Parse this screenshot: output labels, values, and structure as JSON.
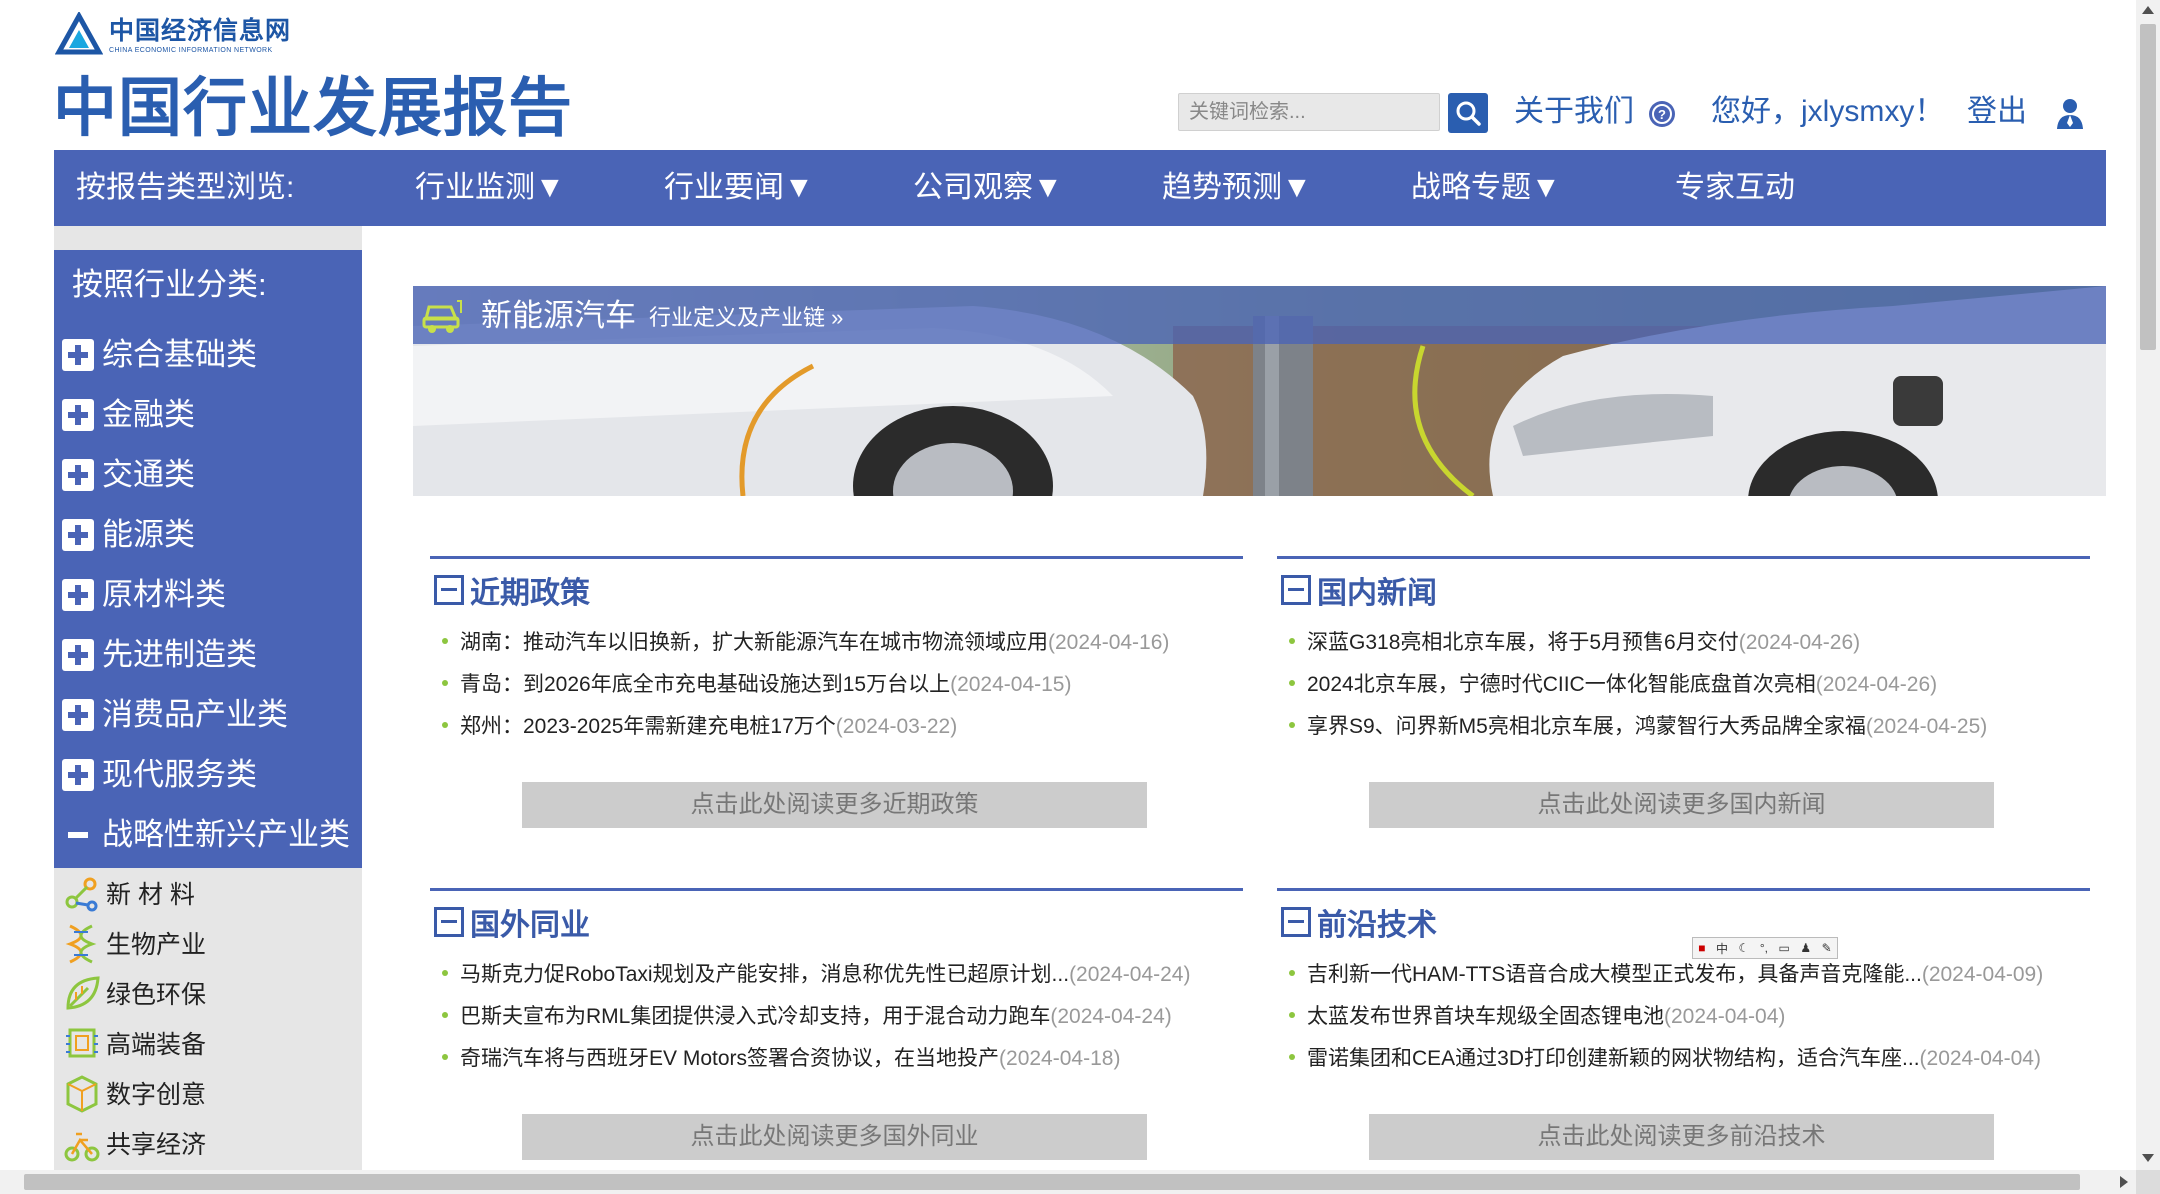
{
  "header": {
    "logo_cn": "中国经济信息网",
    "logo_en": "CHINA ECONOMIC INFORMATION NETWORK",
    "site_title": "中国行业发展报告",
    "search_placeholder": "关键词检索...",
    "about": "关于我们",
    "greeting": "您好，jxlysmxy！",
    "logout": "登出"
  },
  "nav": {
    "browse_label": "按报告类型浏览:",
    "items": [
      "行业监测▼",
      "行业要闻▼",
      "公司观察▼",
      "趋势预测▼",
      "战略专题▼",
      "专家互动"
    ]
  },
  "sidebar": {
    "heading": "按照行业分类:",
    "categories": [
      "综合基础类",
      "金融类",
      "交通类",
      "能源类",
      "原材料类",
      "先进制造类",
      "消费品产业类",
      "现代服务类"
    ],
    "expanded": "战略性新兴产业类",
    "subitems": [
      "新 材 料",
      "生物产业",
      "绿色环保",
      "高端装备",
      "数字创意",
      "共享经济"
    ]
  },
  "banner": {
    "title": "新能源汽车",
    "subtitle": "行业定义及产业链 »"
  },
  "sections": [
    {
      "title": "近期政策",
      "items": [
        {
          "title": "湖南：推动汽车以旧换新，扩大新能源汽车在城市物流领域应用",
          "date": "(2024-04-16)"
        },
        {
          "title": "青岛：到2026年底全市充电基础设施达到15万台以上",
          "date": "(2024-04-15)"
        },
        {
          "title": "郑州：2023-2025年需新建充电桩17万个",
          "date": "(2024-03-22)"
        }
      ],
      "more": "点击此处阅读更多近期政策"
    },
    {
      "title": "国内新闻",
      "items": [
        {
          "title": "深蓝G318亮相北京车展，将于5月预售6月交付",
          "date": "(2024-04-26)"
        },
        {
          "title": "2024北京车展，宁德时代CIIC一体化智能底盘首次亮相",
          "date": "(2024-04-26)"
        },
        {
          "title": "享界S9、问界新M5亮相北京车展，鸿蒙智行大秀品牌全家福",
          "date": "(2024-04-25)"
        }
      ],
      "more": "点击此处阅读更多国内新闻"
    },
    {
      "title": "国外同业",
      "items": [
        {
          "title": "马斯克力促RoboTaxi规划及产能安排，消息称优先性已超原计划...",
          "date": "(2024-04-24)"
        },
        {
          "title": "巴斯夫宣布为RML集团提供浸入式冷却支持，用于混合动力跑车",
          "date": "(2024-04-24)"
        },
        {
          "title": "奇瑞汽车将与西班牙EV Motors签署合资协议，在当地投产",
          "date": "(2024-04-18)"
        }
      ],
      "more": "点击此处阅读更多国外同业"
    },
    {
      "title": "前沿技术",
      "items": [
        {
          "title": "吉利新一代HAM-TTS语音合成大模型正式发布，具备声音克隆能...",
          "date": "(2024-04-09)"
        },
        {
          "title": "太蓝发布世界首块车规级全固态锂电池",
          "date": "(2024-04-04)"
        },
        {
          "title": "雷诺集团和CEA通过3D打印创建新颖的网状物结构，适合汽车座...",
          "date": "(2024-04-04)"
        }
      ],
      "more": "点击此处阅读更多前沿技术"
    }
  ],
  "ime_toolbar": "中"
}
